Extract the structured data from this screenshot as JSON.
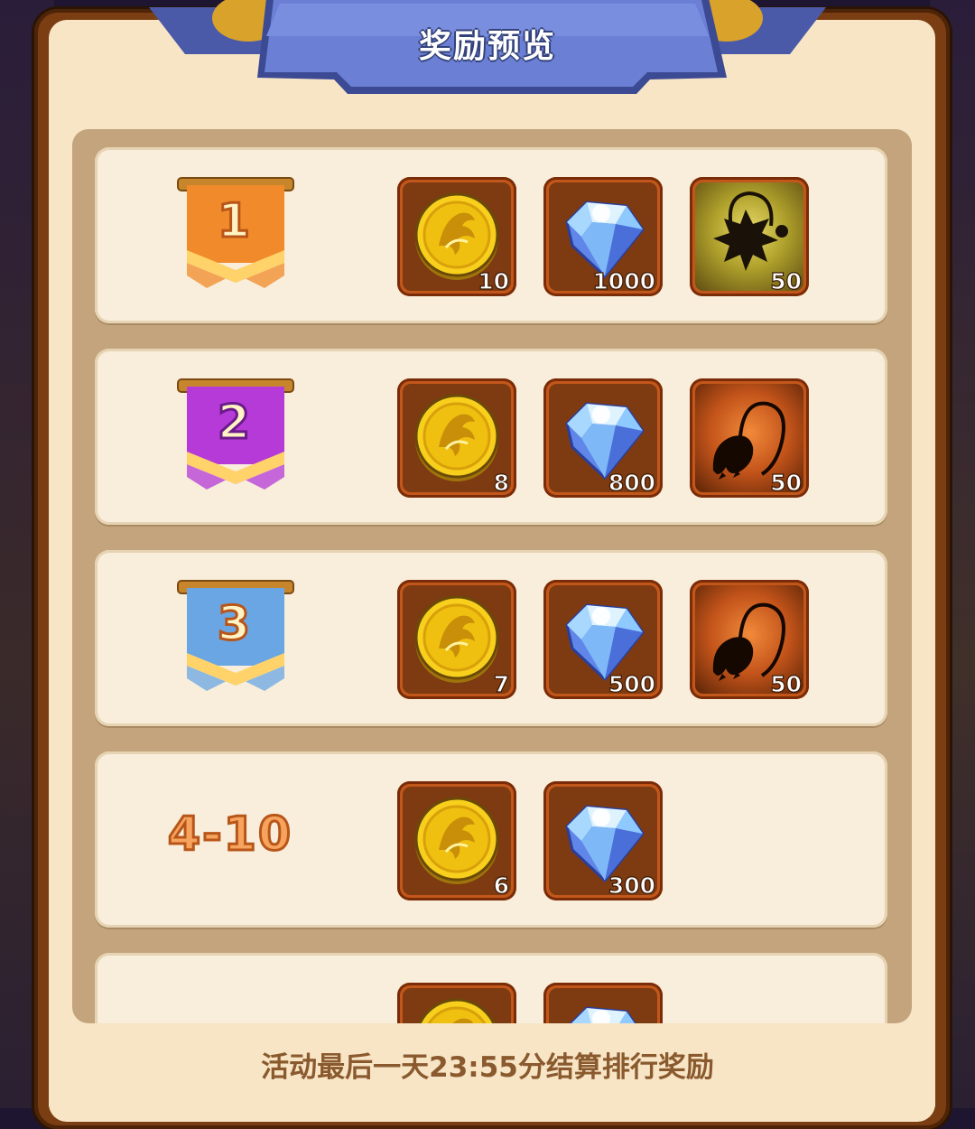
{
  "title": "奖励预览",
  "footer_note": "活动最后一天23:55分结算排行奖励",
  "colors": {
    "frame": "#7a3e12",
    "panel": "#f7e5c6",
    "banner": "#5f72c6",
    "rank1": "#f18a2a",
    "rank2": "#b63ad8",
    "rank3": "#6aa6e4",
    "qty_text": "#ffffff"
  },
  "tiers": [
    {
      "rank": "1",
      "badge_color": "orange",
      "rewards": [
        {
          "icon": "gold-coin-icon",
          "qty": "10"
        },
        {
          "icon": "diamond-icon",
          "qty": "1000"
        },
        {
          "icon": "star-amulet-icon",
          "qty": "50"
        }
      ]
    },
    {
      "rank": "2",
      "badge_color": "purple",
      "rewards": [
        {
          "icon": "gold-coin-icon",
          "qty": "8"
        },
        {
          "icon": "diamond-icon",
          "qty": "800"
        },
        {
          "icon": "claw-necklace-icon",
          "qty": "50"
        }
      ]
    },
    {
      "rank": "3",
      "badge_color": "blue",
      "rewards": [
        {
          "icon": "gold-coin-icon",
          "qty": "7"
        },
        {
          "icon": "diamond-icon",
          "qty": "500"
        },
        {
          "icon": "claw-necklace-icon",
          "qty": "50"
        }
      ]
    },
    {
      "rank": "4-10",
      "rewards": [
        {
          "icon": "gold-coin-icon",
          "qty": "6"
        },
        {
          "icon": "diamond-icon",
          "qty": "300"
        }
      ]
    },
    {
      "rank": "",
      "rewards": [
        {
          "icon": "gold-coin-icon",
          "qty": ""
        },
        {
          "icon": "diamond-icon",
          "qty": ""
        }
      ]
    }
  ]
}
